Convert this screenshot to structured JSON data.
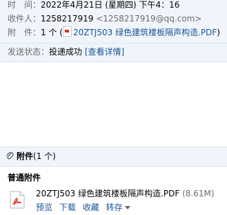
{
  "header": {
    "time_label": "时　间：",
    "time_value": "2022年4月21日 (星期四) 下午4：16",
    "recipient_label": "收件人：",
    "recipient_name": "1258217919",
    "recipient_email": "<1258217919@qq.com>",
    "attachment_label": "附　件：",
    "attachment_count": "1 个",
    "attachment_open_paren": "(",
    "attachment_name": "20ZTJ503 绿色建筑楼板隔声构造.PDF",
    "attachment_close_paren": ")",
    "status_label": "发送状态：",
    "status_value": "投递成功",
    "status_detail_link": "[查看详情]"
  },
  "attachments_section": {
    "title": "附件",
    "count": "(1 个)",
    "group_label": "普通附件",
    "files": [
      {
        "name": "20ZTJ503 绿色建筑楼板隔声构造.PDF",
        "size": "(8.61M)",
        "actions": [
          "预览",
          "下载",
          "收藏",
          "转存"
        ]
      }
    ]
  },
  "colors": {
    "header_bg": "#eff5fb",
    "link": "#1e5494",
    "label_gray": "#6b6b6b",
    "pdf_red": "#e0301e"
  },
  "icons": [
    "pdf-file-icon",
    "paperclip-icon",
    "chevron-down-icon"
  ]
}
